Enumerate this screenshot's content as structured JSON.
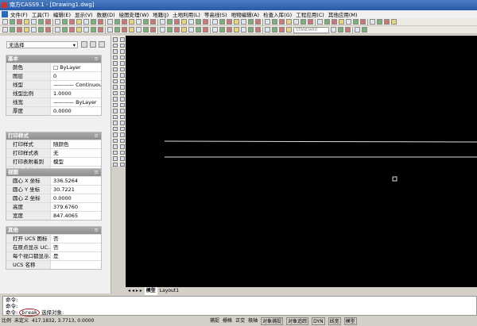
{
  "title": "南方CASS9.1 - [Drawing1.dwg]",
  "menu": [
    "文件(F)",
    "工具(T)",
    "编辑(E)",
    "显示(V)",
    "数据(D)",
    "绘图处理(W)",
    "地籍(J)",
    "土地利用(L)",
    "等高线(S)",
    "地物编辑(A)",
    "检查入库(G)",
    "工程应用(C)",
    "其他应用(M)"
  ],
  "toolbar": {
    "text_style": "STANDARD"
  },
  "properties": {
    "selection": "无选择",
    "sections": [
      {
        "title": "基本",
        "rows": [
          [
            "颜色",
            "□ ByLayer"
          ],
          [
            "图层",
            "0"
          ],
          [
            "线型",
            "———— Continuous"
          ],
          [
            "线型比例",
            "1.0000"
          ],
          [
            "线宽",
            "———— ByLayer"
          ],
          [
            "厚度",
            "0.0000"
          ]
        ]
      },
      {
        "title": "打印样式",
        "rows": [
          [
            "打印样式",
            "随颜色"
          ],
          [
            "打印样式表",
            "无"
          ],
          [
            "打印表附着到",
            "模型"
          ],
          [
            "打印表类型",
            "不可用"
          ]
        ]
      },
      {
        "title": "视图",
        "rows": [
          [
            "圆心 X 坐标",
            "336.5264"
          ],
          [
            "圆心 Y 坐标",
            "30.7221"
          ],
          [
            "圆心 Z 坐标",
            "0.0000"
          ],
          [
            "高度",
            "379.6760"
          ],
          [
            "宽度",
            "847.4065"
          ]
        ]
      },
      {
        "title": "其他",
        "rows": [
          [
            "打开 UCS 图标",
            "否"
          ],
          [
            "在原点显示 UC...",
            "否"
          ],
          [
            "每个视口都显示...",
            "是"
          ],
          [
            "UCS 名称",
            ""
          ]
        ]
      }
    ]
  },
  "tabs": {
    "nav": "◂ ◂ ▸ ▸",
    "model": "模型",
    "layout": "Layout1"
  },
  "command": {
    "line1": "命令:",
    "line2": "命令:",
    "prompt": "命令:",
    "input": "break",
    "tail": "选择对象:"
  },
  "status": {
    "scale": "比例",
    "units": "未定义",
    "coords": "417.1832, 3.7713, 0.0000",
    "toggles": [
      "捕捉",
      "栅格",
      "正交",
      "极轴",
      "对象捕捉",
      "对象追踪",
      "DYN",
      "线宽",
      "模型"
    ]
  }
}
